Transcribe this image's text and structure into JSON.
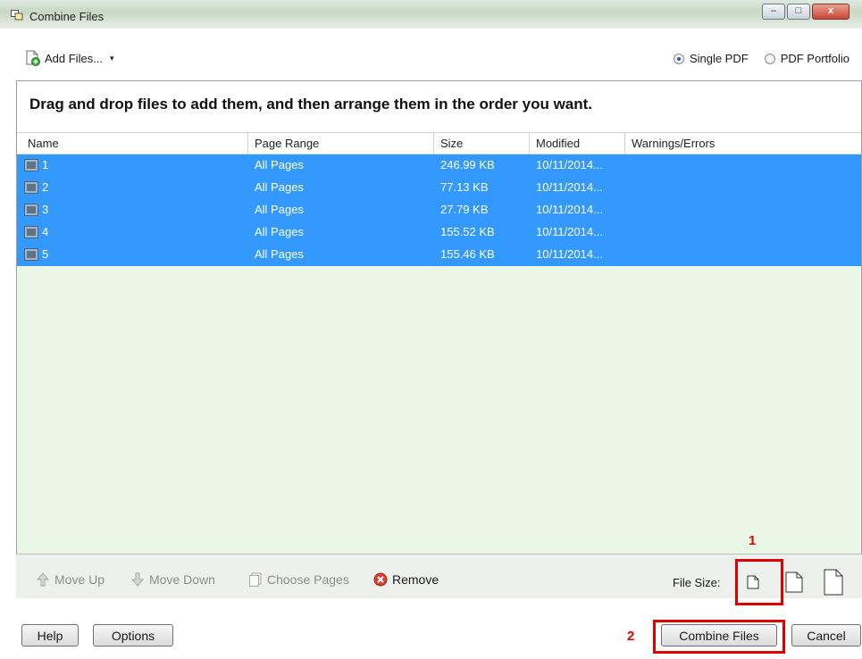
{
  "window": {
    "title": "Combine Files",
    "controls": {
      "minimize": "–",
      "maximize": "□",
      "close": "x"
    }
  },
  "toolbar": {
    "add_files_label": "Add Files...",
    "add_files_caret": "▾",
    "output_options": [
      {
        "label": "Single PDF",
        "selected": true
      },
      {
        "label": "PDF Portfolio",
        "selected": false
      }
    ]
  },
  "instructions": "Drag and drop files to add them, and then arrange them in the order you want.",
  "table": {
    "columns": [
      "Name",
      "Page Range",
      "Size",
      "Modified",
      "Warnings/Errors"
    ],
    "rows": [
      {
        "name": "1",
        "page_range": "All Pages",
        "size": "246.99 KB",
        "modified": "10/11/2014...",
        "warnings": ""
      },
      {
        "name": "2",
        "page_range": "All Pages",
        "size": "77.13 KB",
        "modified": "10/11/2014...",
        "warnings": ""
      },
      {
        "name": "3",
        "page_range": "All Pages",
        "size": "27.79 KB",
        "modified": "10/11/2014...",
        "warnings": ""
      },
      {
        "name": "4",
        "page_range": "All Pages",
        "size": "155.52 KB",
        "modified": "10/11/2014...",
        "warnings": ""
      },
      {
        "name": "5",
        "page_range": "All Pages",
        "size": "155.46 KB",
        "modified": "10/11/2014...",
        "warnings": ""
      }
    ]
  },
  "bottom_toolbar": {
    "move_up": "Move Up",
    "move_down": "Move Down",
    "choose_pages": "Choose Pages",
    "remove": "Remove",
    "file_size_label": "File Size:"
  },
  "annotations": {
    "marker_1": "1",
    "marker_2": "2"
  },
  "footer": {
    "help": "Help",
    "options": "Options",
    "combine": "Combine Files",
    "cancel": "Cancel"
  },
  "colors": {
    "selection": "#3399ff",
    "panel_background": "#eaf7e6",
    "highlight": "#e00000"
  }
}
